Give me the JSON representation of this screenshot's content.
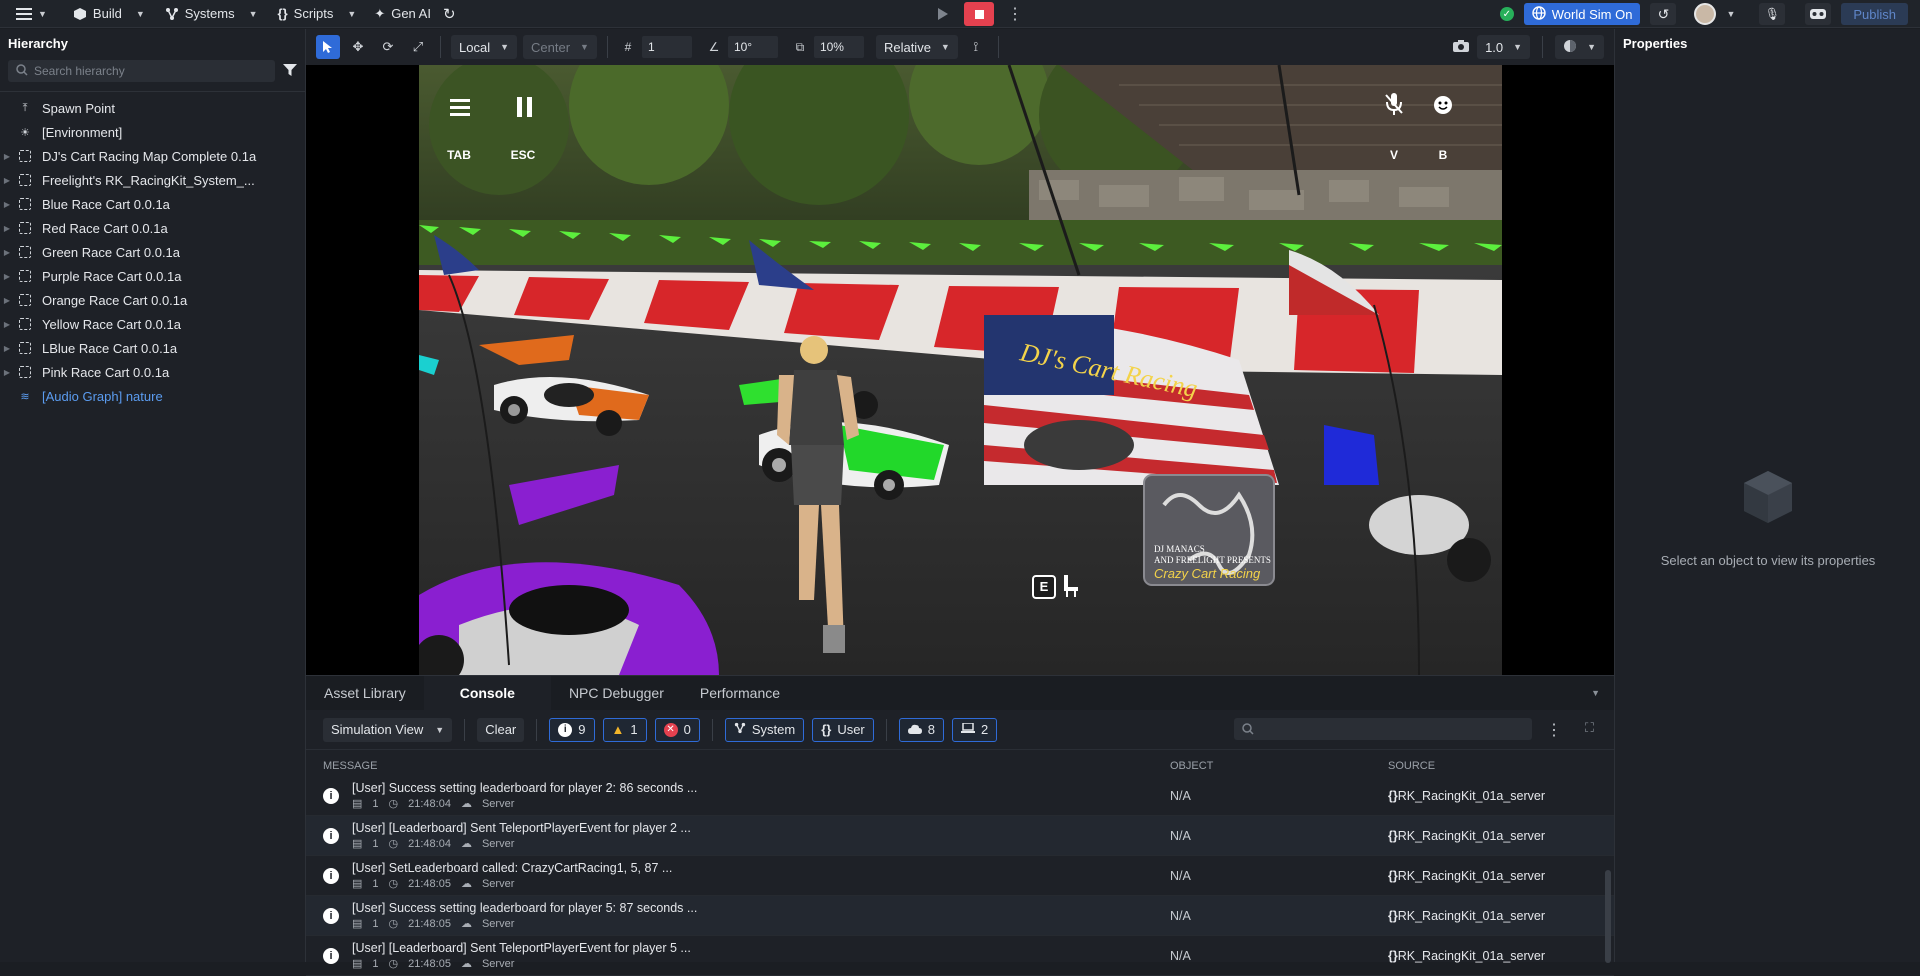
{
  "topbar": {
    "build_label": "Build",
    "systems_label": "Systems",
    "scripts_label": "Scripts",
    "genai_label": "Gen AI",
    "worldsim_label": "World Sim On",
    "publish_label": "Publish"
  },
  "hierarchy": {
    "title": "Hierarchy",
    "search_placeholder": "Search hierarchy",
    "items": [
      {
        "label": "Spawn Point",
        "icon": "spawn-icon"
      },
      {
        "label": "[Environment]",
        "icon": "sun-icon"
      },
      {
        "label": "DJ's Cart Racing Map Complete 0.1a",
        "icon": "group-icon"
      },
      {
        "label": "Freelight's RK_RacingKit_System_...",
        "icon": "group-icon"
      },
      {
        "label": "Blue Race Cart 0.0.1a",
        "icon": "group-icon"
      },
      {
        "label": "Red Race Cart 0.0.1a",
        "icon": "group-icon"
      },
      {
        "label": "Green Race Cart 0.0.1a",
        "icon": "group-icon"
      },
      {
        "label": "Purple Race Cart 0.0.1a",
        "icon": "group-icon"
      },
      {
        "label": "Orange Race Cart 0.0.1a",
        "icon": "group-icon"
      },
      {
        "label": "Yellow Race Cart 0.0.1a",
        "icon": "group-icon"
      },
      {
        "label": "LBlue Race Cart 0.0.1a",
        "icon": "group-icon"
      },
      {
        "label": "Pink Race Cart 0.0.1a",
        "icon": "group-icon"
      },
      {
        "label": "[Audio Graph] nature",
        "icon": "audio-icon"
      }
    ]
  },
  "toolbar": {
    "space_mode": "Local",
    "pivot_mode": "Center",
    "grid_snap": "1",
    "rotation_snap": "10°",
    "scale_snap": "10%",
    "relative_mode": "Relative",
    "camera_speed": "1.0"
  },
  "viewport": {
    "hud": {
      "menu_key": "TAB",
      "pause_key": "ESC",
      "mic_key": "V",
      "emote_key": "B",
      "interact_key": "E"
    },
    "billboard": {
      "title": "DJ's Cart Racing",
      "line1": "DJ MANACS",
      "line2": "AND FREELIGHT PRESENTS",
      "line3": "Crazy Cart Racing"
    }
  },
  "properties": {
    "title": "Properties",
    "empty_text": "Select an object to view its properties"
  },
  "console": {
    "tabs": [
      "Asset Library",
      "Console",
      "NPC Debugger",
      "Performance"
    ],
    "active_tab": "Console",
    "view_mode": "Simulation View",
    "clear_label": "Clear",
    "info_count": "9",
    "warn_count": "1",
    "error_count": "0",
    "system_label": "System",
    "user_label": "User",
    "server_count": "8",
    "client_count": "2",
    "columns": {
      "message": "MESSAGE",
      "object": "OBJECT",
      "source": "SOURCE"
    },
    "rows": [
      {
        "message": "[User] Success setting leaderboard for player 2: 86 seconds ...",
        "count": "1",
        "time": "21:48:04",
        "origin": "Server",
        "object": "N/A",
        "source": "RK_RacingKit_01a_server"
      },
      {
        "message": "[User] [Leaderboard] Sent TeleportPlayerEvent for player 2 ...",
        "count": "1",
        "time": "21:48:04",
        "origin": "Server",
        "object": "N/A",
        "source": "RK_RacingKit_01a_server"
      },
      {
        "message": "[User] SetLeaderboard called: CrazyCartRacing1, 5, 87 ...",
        "count": "1",
        "time": "21:48:05",
        "origin": "Server",
        "object": "N/A",
        "source": "RK_RacingKit_01a_server"
      },
      {
        "message": "[User] Success setting leaderboard for player 5: 87 seconds ...",
        "count": "1",
        "time": "21:48:05",
        "origin": "Server",
        "object": "N/A",
        "source": "RK_RacingKit_01a_server"
      },
      {
        "message": "[User] [Leaderboard] Sent TeleportPlayerEvent for player 5 ...",
        "count": "1",
        "time": "21:48:05",
        "origin": "Server",
        "object": "N/A",
        "source": "RK_RacingKit_01a_server"
      }
    ]
  },
  "colors": {
    "accent": "#2f6bd8",
    "stop": "#e5414f",
    "ok": "#27b05a",
    "warning": "#f3b52a"
  }
}
